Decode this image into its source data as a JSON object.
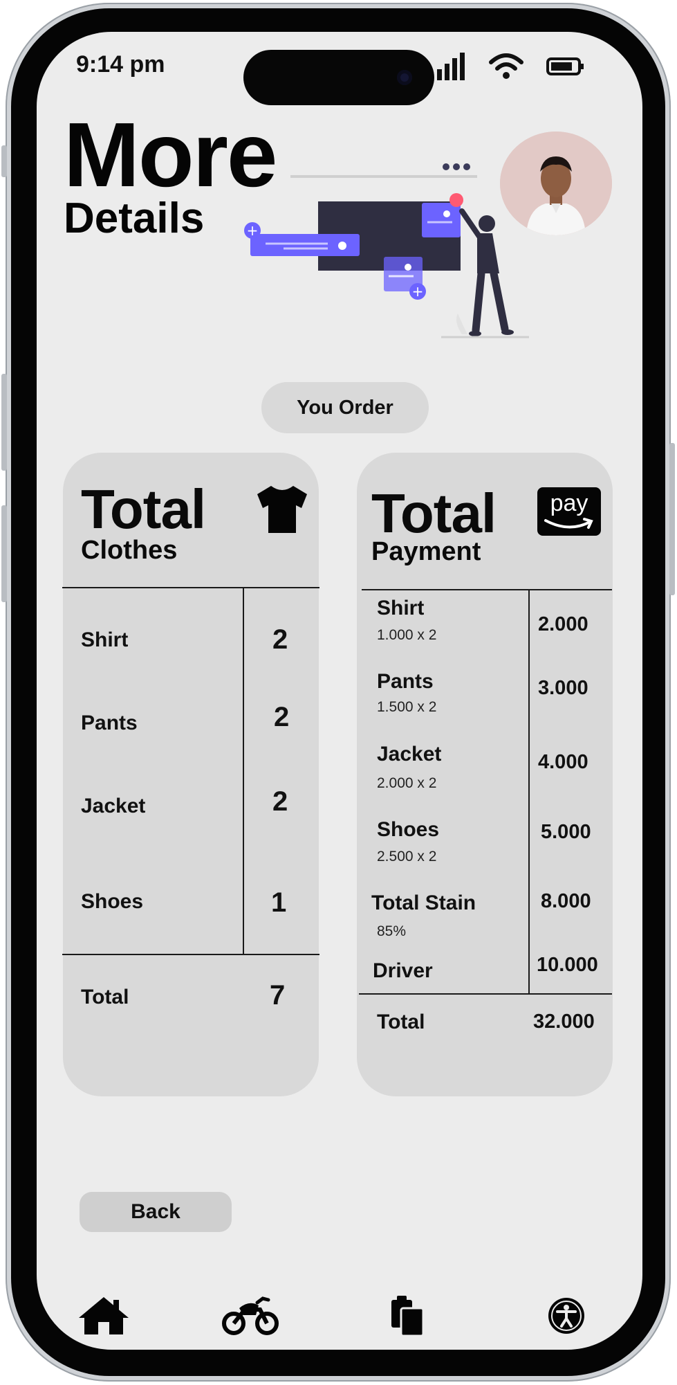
{
  "status_bar": {
    "time": "9:14 pm"
  },
  "header": {
    "title_line1": "More",
    "title_line2": "Details"
  },
  "order_pill": {
    "label": "You Order"
  },
  "clothes_card": {
    "title": "Total",
    "subtitle": "Clothes",
    "items": [
      {
        "label": "Shirt",
        "qty": "2"
      },
      {
        "label": "Pants",
        "qty": "2"
      },
      {
        "label": "Jacket",
        "qty": "2"
      },
      {
        "label": "Shoes",
        "qty": "1"
      }
    ],
    "total_label": "Total",
    "total_value": "7"
  },
  "payment_card": {
    "title": "Total",
    "subtitle": "Payment",
    "pay_badge": "pay",
    "items": [
      {
        "label": "Shirt",
        "detail": "1.000 x 2",
        "amount": "2.000"
      },
      {
        "label": "Pants",
        "detail": "1.500 x 2",
        "amount": "3.000"
      },
      {
        "label": "Jacket",
        "detail": "2.000 x 2",
        "amount": "4.000"
      },
      {
        "label": "Shoes",
        "detail": "2.500 x 2",
        "amount": "5.000"
      },
      {
        "label": "Total Stain",
        "detail": "85%",
        "amount": "8.000"
      },
      {
        "label": "Driver",
        "detail": "",
        "amount": "10.000"
      }
    ],
    "total_label": "Total",
    "total_value": "32.000"
  },
  "back_button": {
    "label": "Back"
  },
  "bottom_nav": [
    "home-icon",
    "motorcycle-icon",
    "clipboard-icon",
    "accessibility-icon"
  ],
  "colors": {
    "screen_bg": "#ececec",
    "card_bg": "#d9d9d9",
    "accent": "#6c63ff",
    "dot_red": "#ff5a72"
  }
}
